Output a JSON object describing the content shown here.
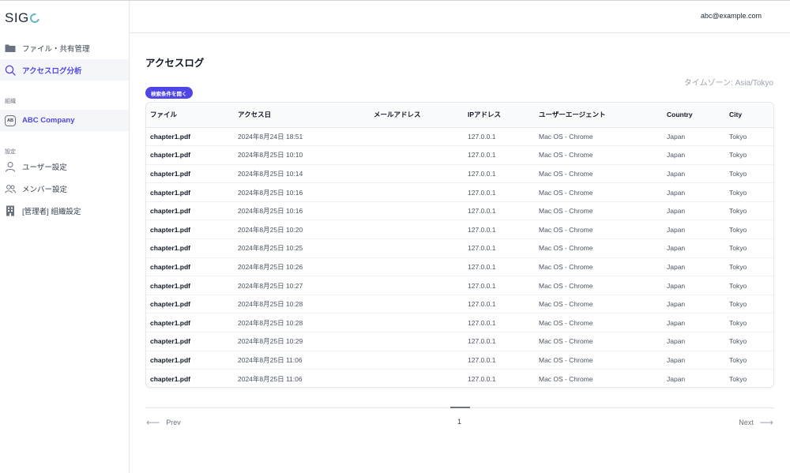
{
  "brand": {
    "logo_text": "SIG"
  },
  "header": {
    "user_email": "abc@example.com"
  },
  "sidebar": {
    "items": [
      {
        "label": "ファイル・共有管理",
        "icon": "folder-icon"
      },
      {
        "label": "アクセスログ分析",
        "icon": "search-icon",
        "active": true
      }
    ],
    "org_section_label": "組織",
    "org": {
      "badge": "AB",
      "name": "ABC Company"
    },
    "settings_section_label": "設定",
    "settings_items": [
      {
        "label": "ユーザー設定",
        "icon": "user-icon"
      },
      {
        "label": "メンバー設定",
        "icon": "users-icon"
      },
      {
        "label": "[管理者] 組織設定",
        "icon": "building-icon"
      }
    ]
  },
  "main": {
    "title": "アクセスログ",
    "timezone": "タイムゾーン: Asia/Tokyo",
    "search_button_label": "検索条件を開く"
  },
  "table": {
    "columns": [
      "ファイル",
      "アクセス日",
      "メールアドレス",
      "IPアドレス",
      "ユーザーエージェント",
      "Country",
      "City"
    ],
    "rows": [
      {
        "file": "chapter1.pdf",
        "date": "2024年8月24日 18:51",
        "email": "",
        "ip": "127.0.0.1",
        "ua": "Mac OS - Chrome",
        "country": "Japan",
        "city": "Tokyo"
      },
      {
        "file": "chapter1.pdf",
        "date": "2024年8月25日 10:10",
        "email": "",
        "ip": "127.0.0.1",
        "ua": "Mac OS - Chrome",
        "country": "Japan",
        "city": "Tokyo"
      },
      {
        "file": "chapter1.pdf",
        "date": "2024年8月25日 10:14",
        "email": "",
        "ip": "127.0.0.1",
        "ua": "Mac OS - Chrome",
        "country": "Japan",
        "city": "Tokyo"
      },
      {
        "file": "chapter1.pdf",
        "date": "2024年8月25日 10:16",
        "email": "",
        "ip": "127.0.0.1",
        "ua": "Mac OS - Chrome",
        "country": "Japan",
        "city": "Tokyo"
      },
      {
        "file": "chapter1.pdf",
        "date": "2024年8月25日 10:16",
        "email": "",
        "ip": "127.0.0.1",
        "ua": "Mac OS - Chrome",
        "country": "Japan",
        "city": "Tokyo"
      },
      {
        "file": "chapter1.pdf",
        "date": "2024年8月25日 10:20",
        "email": "",
        "ip": "127.0.0.1",
        "ua": "Mac OS - Chrome",
        "country": "Japan",
        "city": "Tokyo"
      },
      {
        "file": "chapter1.pdf",
        "date": "2024年8月25日 10:25",
        "email": "",
        "ip": "127.0.0.1",
        "ua": "Mac OS - Chrome",
        "country": "Japan",
        "city": "Tokyo"
      },
      {
        "file": "chapter1.pdf",
        "date": "2024年8月25日 10:26",
        "email": "",
        "ip": "127.0.0.1",
        "ua": "Mac OS - Chrome",
        "country": "Japan",
        "city": "Tokyo"
      },
      {
        "file": "chapter1.pdf",
        "date": "2024年8月25日 10:27",
        "email": "",
        "ip": "127.0.0.1",
        "ua": "Mac OS - Chrome",
        "country": "Japan",
        "city": "Tokyo"
      },
      {
        "file": "chapter1.pdf",
        "date": "2024年8月25日 10:28",
        "email": "",
        "ip": "127.0.0.1",
        "ua": "Mac OS - Chrome",
        "country": "Japan",
        "city": "Tokyo"
      },
      {
        "file": "chapter1.pdf",
        "date": "2024年8月25日 10:28",
        "email": "",
        "ip": "127.0.0.1",
        "ua": "Mac OS - Chrome",
        "country": "Japan",
        "city": "Tokyo"
      },
      {
        "file": "chapter1.pdf",
        "date": "2024年8月25日 10:29",
        "email": "",
        "ip": "127.0.0.1",
        "ua": "Mac OS - Chrome",
        "country": "Japan",
        "city": "Tokyo"
      },
      {
        "file": "chapter1.pdf",
        "date": "2024年8月25日 11:06",
        "email": "",
        "ip": "127.0.0.1",
        "ua": "Mac OS - Chrome",
        "country": "Japan",
        "city": "Tokyo"
      },
      {
        "file": "chapter1.pdf",
        "date": "2024年8月25日 11:06",
        "email": "",
        "ip": "127.0.0.1",
        "ua": "Mac OS - Chrome",
        "country": "Japan",
        "city": "Tokyo"
      }
    ]
  },
  "pagination": {
    "prev_label": "Prev",
    "next_label": "Next",
    "current_page": "1",
    "prev_arrow": "⟵",
    "next_arrow": "⟶"
  },
  "colors": {
    "accent": "#4f46e5",
    "logo_accent": "#5eb6c8",
    "active_bg": "#f5f6fa"
  }
}
